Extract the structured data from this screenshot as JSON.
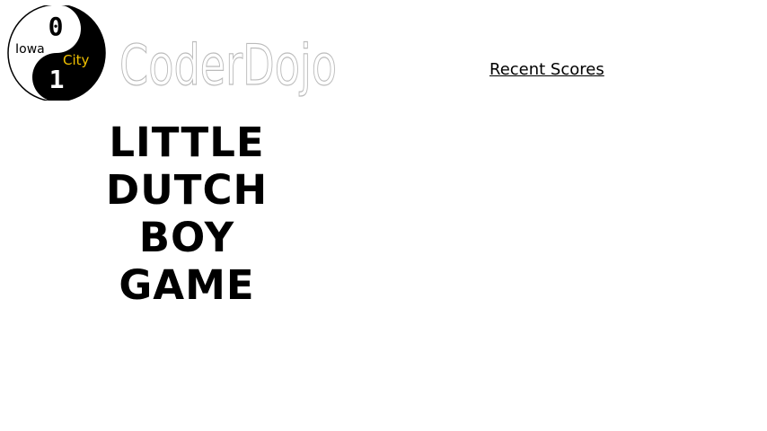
{
  "header": {
    "logo": {
      "brand_text": "CoderDojo",
      "city_left": "Iowa",
      "city_right": "City",
      "digit_top": "0",
      "digit_bottom": "1",
      "colors": {
        "dark": "#000000",
        "light": "#ffffff",
        "accent": "#f2c200",
        "outline": "#bbbbbb"
      }
    },
    "nav": {
      "recent_scores_label": "Recent Scores"
    }
  },
  "main": {
    "title_lines": [
      "LITTLE",
      "DUTCH",
      "BOY",
      "GAME"
    ]
  }
}
